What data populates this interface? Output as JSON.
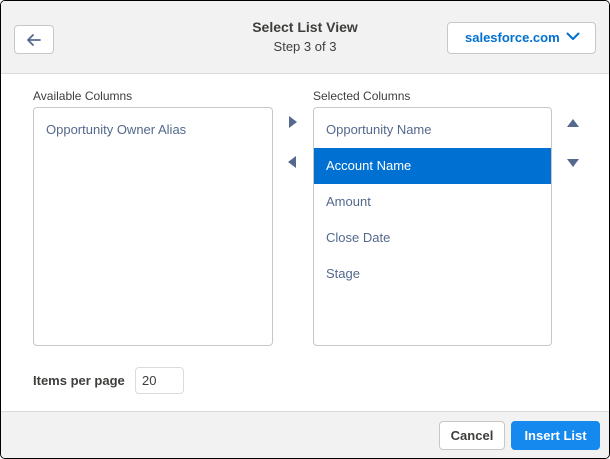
{
  "header": {
    "title": "Select List View",
    "subtitle": "Step 3 of 3",
    "back_icon": "arrow-left-icon",
    "org_select": {
      "value": "salesforce.com",
      "icon": "chevron-down-icon"
    }
  },
  "available": {
    "label": "Available Columns",
    "items": [
      {
        "label": "Opportunity Owner Alias"
      }
    ]
  },
  "selected": {
    "label": "Selected Columns",
    "items": [
      {
        "label": "Opportunity Name",
        "selected": false
      },
      {
        "label": "Account Name",
        "selected": true
      },
      {
        "label": "Amount",
        "selected": false
      },
      {
        "label": "Close Date",
        "selected": false
      },
      {
        "label": "Stage",
        "selected": false
      }
    ]
  },
  "transfer": {
    "add_icon": "triangle-right-icon",
    "remove_icon": "triangle-left-icon"
  },
  "reorder": {
    "up_icon": "triangle-up-icon",
    "down_icon": "triangle-down-icon"
  },
  "items_per_page": {
    "label": "Items per page",
    "value": "20"
  },
  "footer": {
    "cancel_label": "Cancel",
    "insert_label": "Insert List"
  },
  "colors": {
    "accent": "#0070d2",
    "primary_button": "#1589ee",
    "header_bg": "#f3f2f2"
  }
}
